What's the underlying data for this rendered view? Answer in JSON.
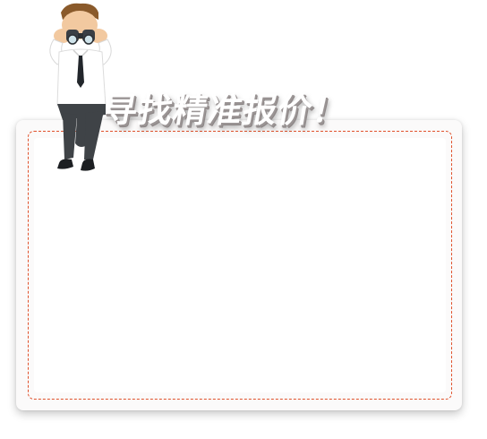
{
  "banner": {
    "title": "寻找精准报价！"
  },
  "colors": {
    "dashed_border": "#e0522c",
    "card_background": "#fbfafa",
    "title_fill": "#ffffff",
    "title_shadow": "#9a9494"
  },
  "illustration": {
    "icon": "businessman-with-binoculars"
  }
}
